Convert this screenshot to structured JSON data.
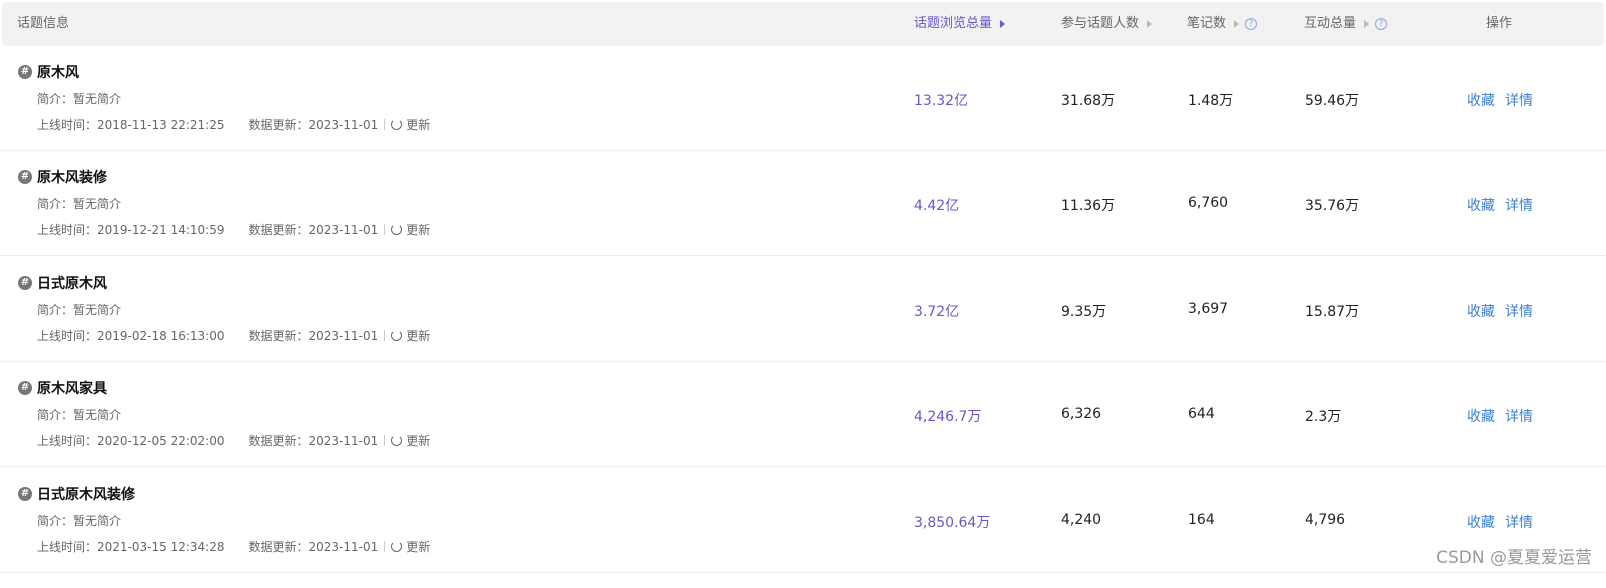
{
  "header": {
    "topic_info": "话题信息",
    "views_total": "话题浏览总量",
    "participants": "参与话题人数",
    "notes": "笔记数",
    "interactions": "互动总量",
    "actions": "操作"
  },
  "labels": {
    "intro_prefix": "简介：",
    "online_prefix": "上线时间：",
    "data_update_prefix": "数据更新：",
    "refresh": "更新",
    "favorite": "收藏",
    "detail": "详情"
  },
  "rows": [
    {
      "name": "原木风",
      "intro": "暂无简介",
      "online": "2018-11-13 22:21:25",
      "updated": "2023-11-01",
      "views": "13.32亿",
      "participants": "31.68万",
      "notes": "1.48万",
      "interactions": "59.46万"
    },
    {
      "name": "原木风装修",
      "intro": "暂无简介",
      "online": "2019-12-21 14:10:59",
      "updated": "2023-11-01",
      "views": "4.42亿",
      "participants": "11.36万",
      "notes": "6,760",
      "interactions": "35.76万"
    },
    {
      "name": "日式原木风",
      "intro": "暂无简介",
      "online": "2019-02-18 16:13:00",
      "updated": "2023-11-01",
      "views": "3.72亿",
      "participants": "9.35万",
      "notes": "3,697",
      "interactions": "15.87万"
    },
    {
      "name": "原木风家具",
      "intro": "暂无简介",
      "online": "2020-12-05 22:02:00",
      "updated": "2023-11-01",
      "views": "4,246.7万",
      "participants": "6,326",
      "notes": "644",
      "interactions": "2.3万"
    },
    {
      "name": "日式原木风装修",
      "intro": "暂无简介",
      "online": "2021-03-15 12:34:28",
      "updated": "2023-11-01",
      "views": "3,850.64万",
      "participants": "4,240",
      "notes": "164",
      "interactions": "4,796"
    }
  ],
  "watermark": "CSDN @夏夏爱运营"
}
